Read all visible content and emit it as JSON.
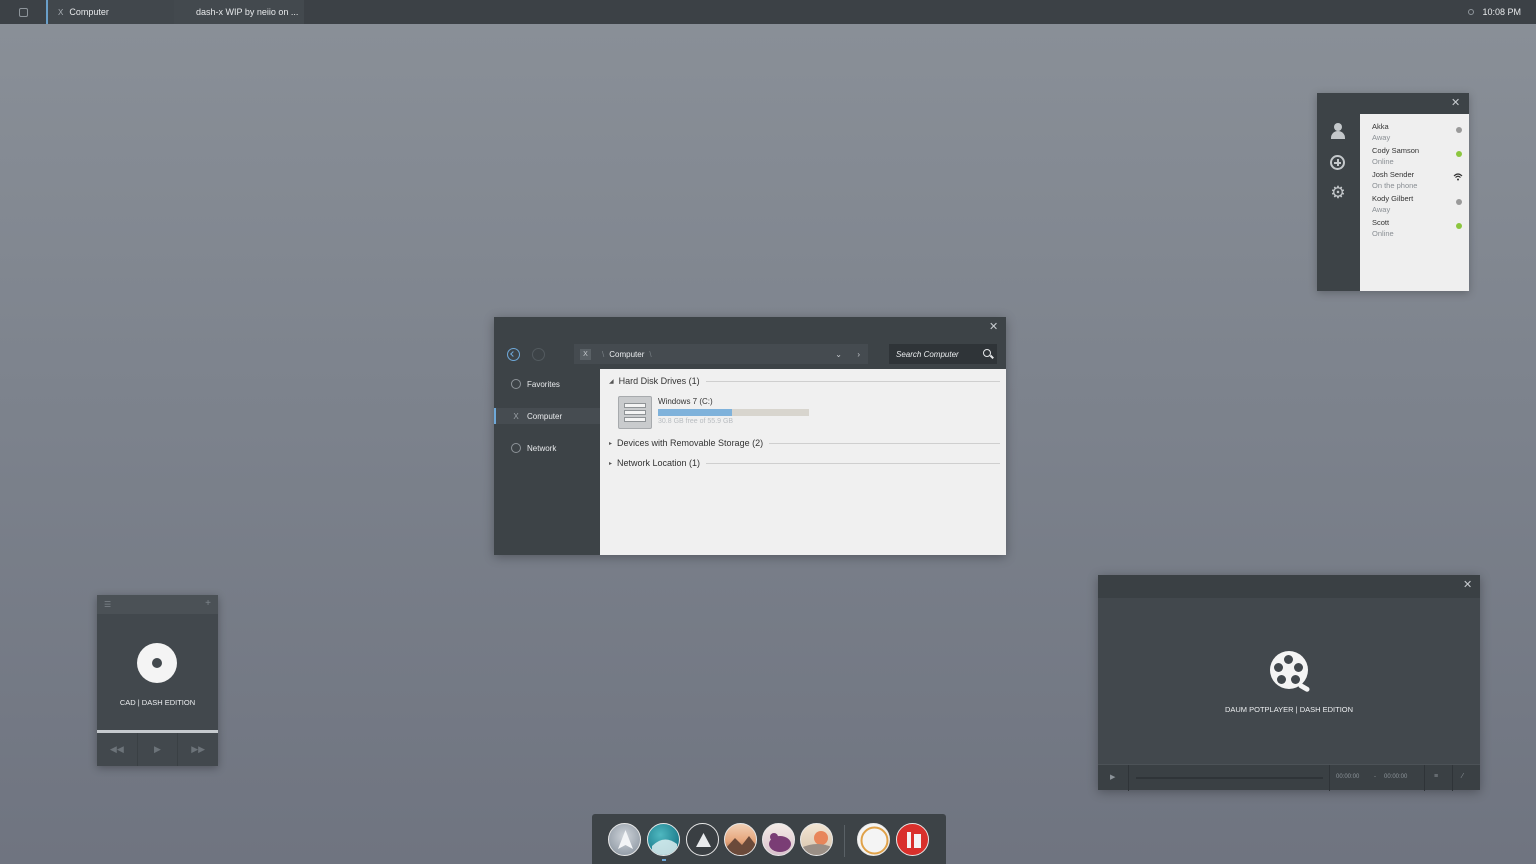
{
  "taskbar": {
    "tasks": [
      {
        "label": "Computer",
        "icon": "X"
      },
      {
        "label": "dash-x WIP by neiio on ..."
      }
    ],
    "clock": "10:08 PM"
  },
  "explorer": {
    "close": "✕",
    "address": {
      "icon": "X",
      "sep": "\\",
      "path": "Computer",
      "trail": "\\"
    },
    "search_placeholder": "Search Computer",
    "sidebar": [
      {
        "label": "Favorites"
      },
      {
        "label": "Computer",
        "icon": "X"
      },
      {
        "label": "Network"
      }
    ],
    "groups": [
      {
        "label": "Hard Disk Drives (1)",
        "expanded": true
      },
      {
        "label": "Devices with Removable Storage (2)",
        "expanded": false
      },
      {
        "label": "Network Location (1)",
        "expanded": false
      }
    ],
    "drive": {
      "name": "Windows 7 (C:)",
      "free_text": "30.8 GB free of 55.9 GB",
      "used_fraction": 0.49
    }
  },
  "contacts": {
    "close": "✕",
    "people": [
      {
        "name": "Akka",
        "status": "Away",
        "indicator": "gray"
      },
      {
        "name": "Cody Samson",
        "status": "Online",
        "indicator": "green"
      },
      {
        "name": "Josh Sender",
        "status": "On the phone",
        "indicator": "phone"
      },
      {
        "name": "Kody Gilbert",
        "status": "Away",
        "indicator": "gray"
      },
      {
        "name": "Scott",
        "status": "Online",
        "indicator": "green"
      }
    ]
  },
  "cad": {
    "title": "CAD | DASH EDITION",
    "menu": "☰",
    "plus": "+"
  },
  "potplayer": {
    "close": "✕",
    "title": "DAUM POTPLAYER | DASH EDITION",
    "time_current": "00:00:00",
    "time_sep": "-",
    "time_total": "00:00:00"
  },
  "colors": {
    "accent": "#6ea8d8",
    "online": "#8cc63f",
    "away": "#9a9a9a"
  }
}
